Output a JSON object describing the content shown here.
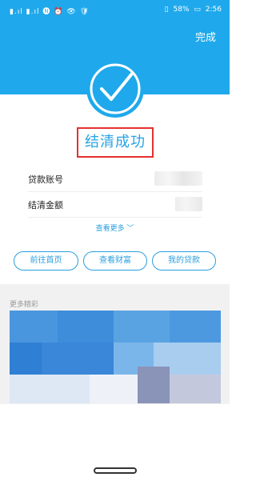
{
  "status_bar": {
    "left_icons": "▮.ıl ▮.ıl 🅝 ⏰ 👁 🛡",
    "battery": "58%",
    "time": "2:56"
  },
  "header": {
    "done_label": "完成"
  },
  "result": {
    "title": "结清成功"
  },
  "details": {
    "rows": [
      {
        "label": "贷款账号"
      },
      {
        "label": "结清金额"
      }
    ]
  },
  "more_link": "查看更多 ﹀",
  "actions": {
    "home": "前往首页",
    "wealth": "查看财富",
    "loans": "我的贷款"
  },
  "more_section": {
    "label": "更多精彩"
  },
  "colors": {
    "primary_blue": "#1fa9ec",
    "accent_text": "#27a3e5",
    "highlight_red": "#e53030"
  },
  "icons": {
    "checkmark": "check-circle-icon"
  }
}
